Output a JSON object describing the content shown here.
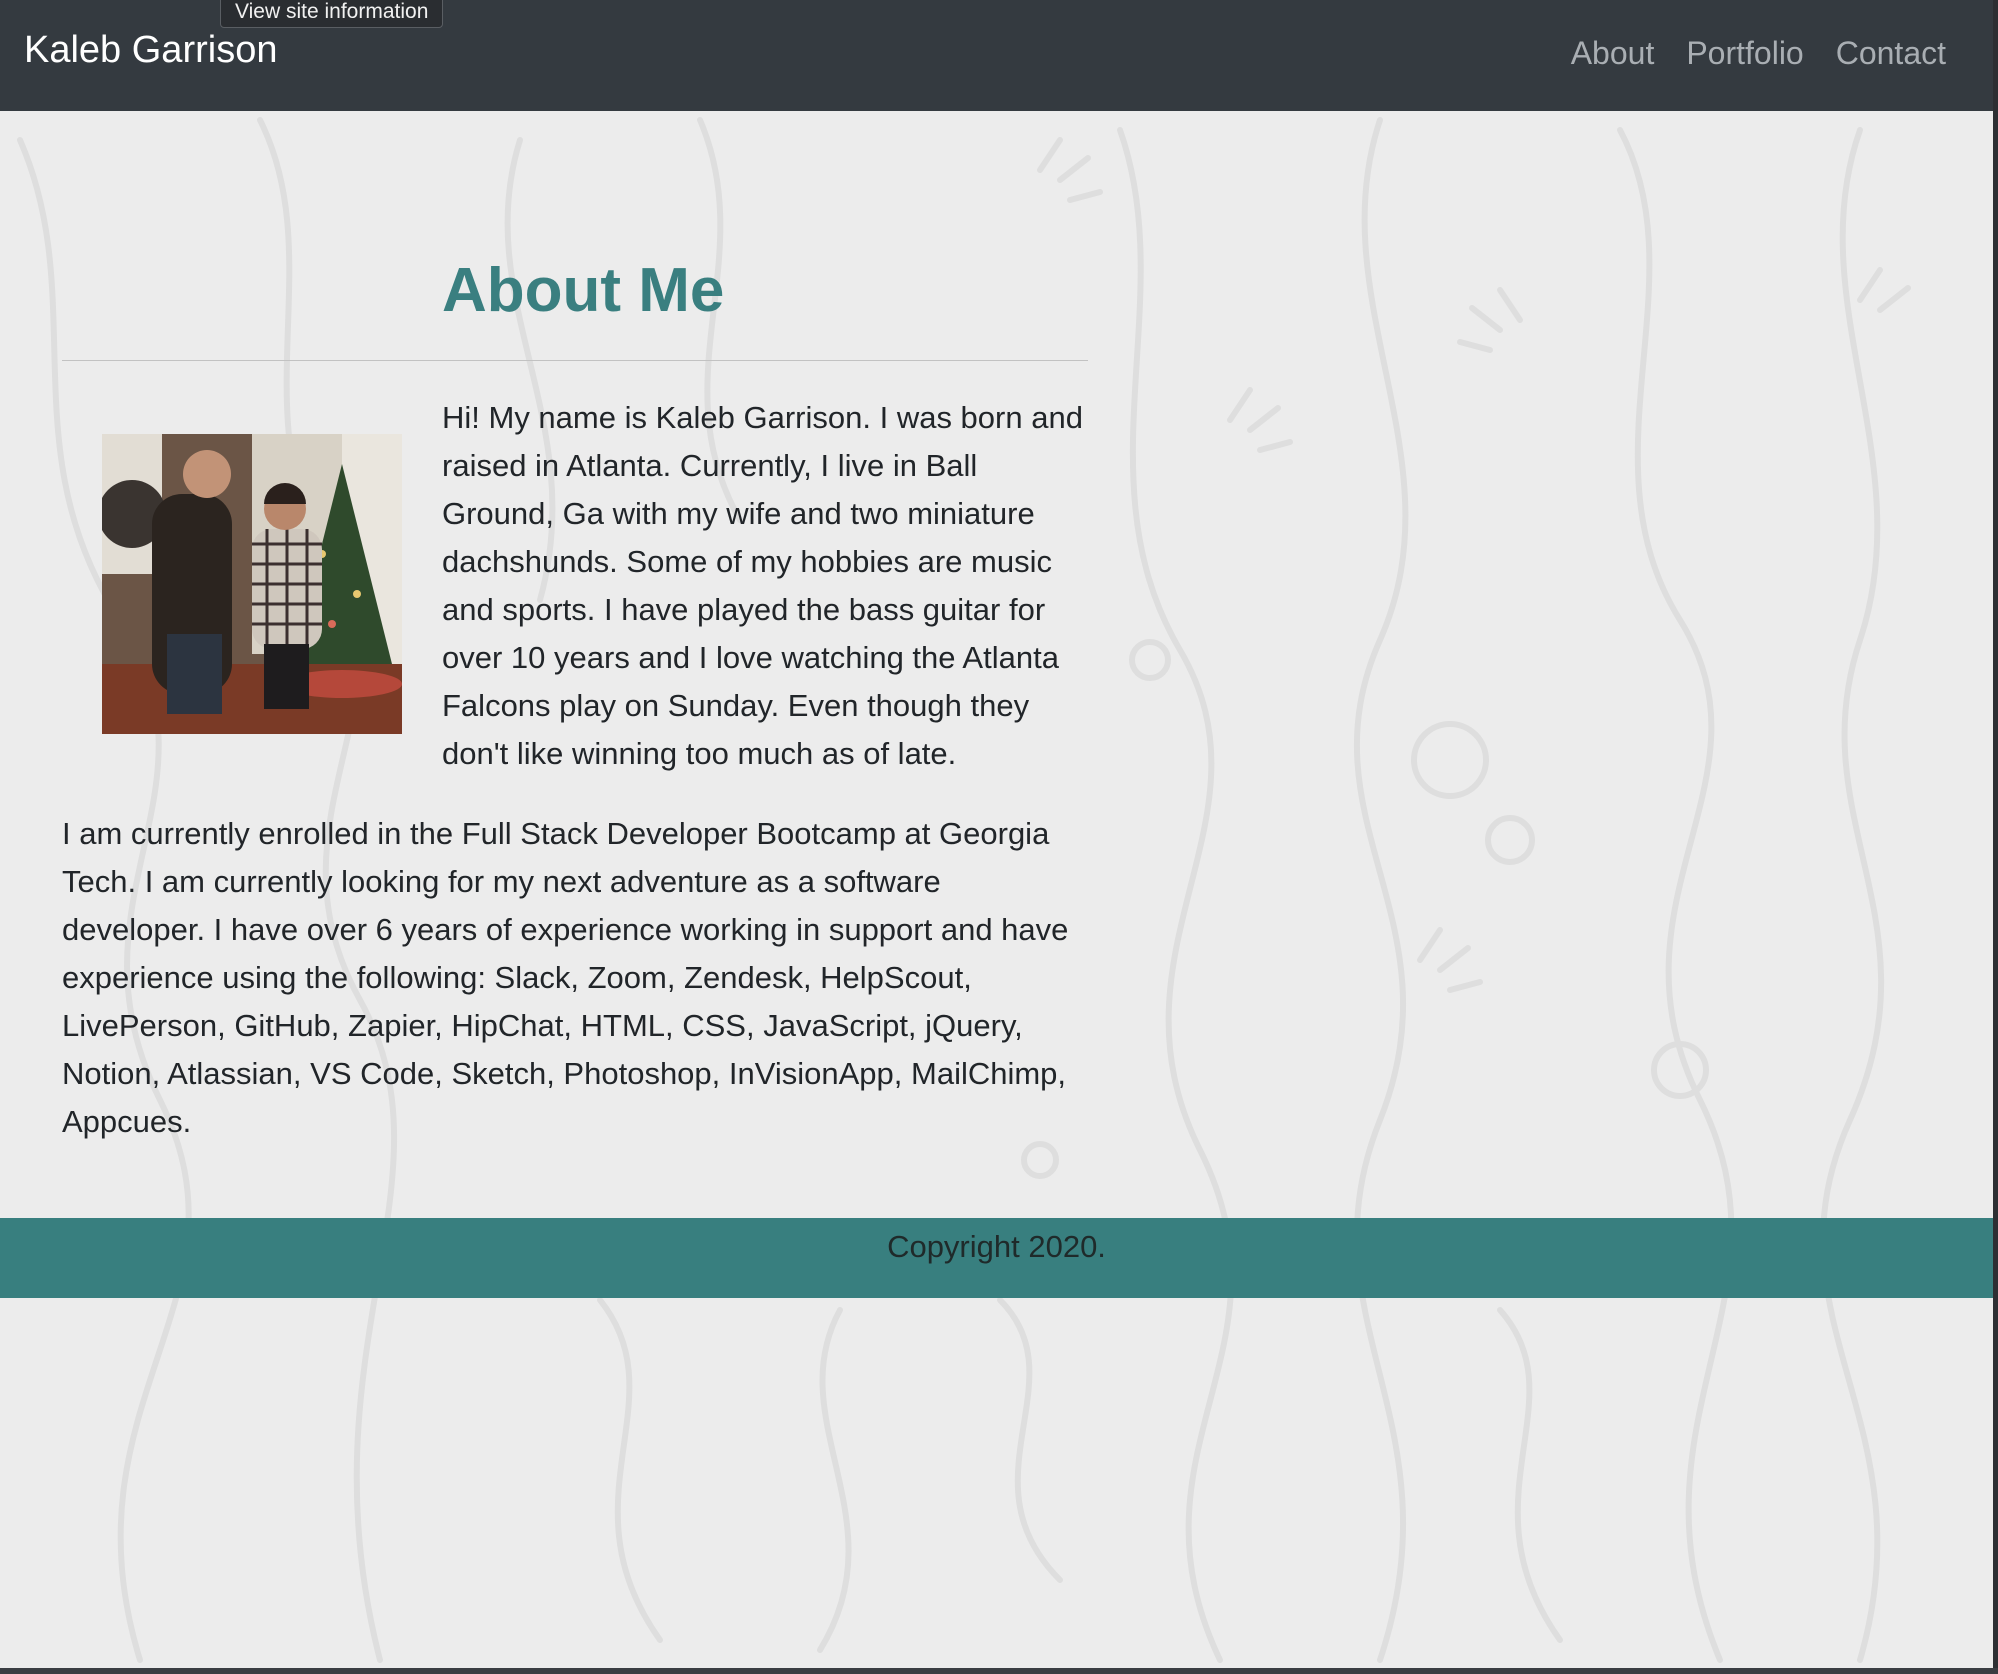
{
  "tooltip": "View site information",
  "navbar": {
    "brand": "Kaleb Garrison",
    "links": [
      {
        "label": "About"
      },
      {
        "label": "Portfolio"
      },
      {
        "label": "Contact"
      }
    ]
  },
  "main": {
    "title": "About Me",
    "intro": "Hi! My name is Kaleb Garrison. I was born and raised in Atlanta. Currently, I live in Ball Ground, Ga with my wife and two miniature dachshunds. Some of my hobbies are music and sports. I have played the bass guitar for over 10 years and I love watching the Atlanta Falcons play on Sunday. Even though they don't like winning too much as of late.",
    "body": "I am currently enrolled in the Full Stack Developer Bootcamp at Georgia Tech. I am currently looking for my next adventure as a software developer. I have over 6 years of experience working in support and have experience using the following: Slack, Zoom, Zendesk, HelpScout, LivePerson, GitHub, Zapier, HipChat, HTML, CSS, JavaScript, jQuery, Notion, Atlassian, VS Code, Sketch, Photoshop, InVisionApp, MailChimp, Appcues."
  },
  "footer": {
    "copyright": "Copyright 2020."
  },
  "colors": {
    "navbar": "#343a40",
    "accent": "#3a7f80",
    "footer": "#387f7f",
    "background": "#ececec"
  }
}
